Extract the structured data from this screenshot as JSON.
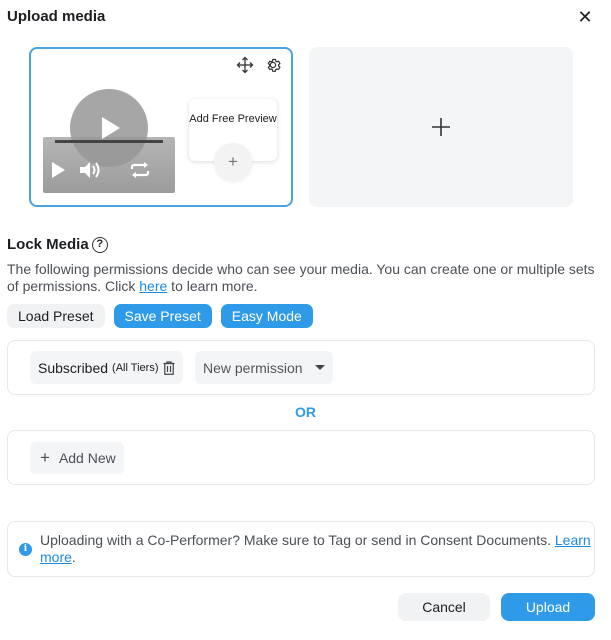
{
  "dialog": {
    "title": "Upload media",
    "close_icon": "close-icon"
  },
  "media": {
    "preview_card": {
      "move_icon": "move-icon",
      "settings_icon": "gear-icon",
      "add_free_preview_label": "Add Free Preview",
      "add_icon": "plus-icon"
    },
    "add_card_icon": "plus-icon"
  },
  "lock_media": {
    "title": "Lock Media",
    "help_icon": "question-circle-icon",
    "description_prefix": "The following permissions decide who can see your media. You can create one or multiple sets of permissions. Click ",
    "description_link": "here",
    "description_suffix": " to learn more.",
    "buttons": {
      "load_preset": "Load Preset",
      "save_preset": "Save Preset",
      "easy_mode": "Easy Mode"
    },
    "permission": {
      "subscribed_label": "Subscribed",
      "subscribed_tiers": "(All Tiers)",
      "trash_icon": "trash-icon",
      "new_permission_label": "New permission",
      "dropdown_icon": "caret-down-icon"
    },
    "or_label": "OR",
    "add_new_label": "Add New"
  },
  "notice": {
    "info_icon": "info-icon",
    "text": "Uploading with a Co-Performer? Make sure to Tag or send in Consent Documents. ",
    "link": "Learn more",
    "suffix": "."
  },
  "footer": {
    "cancel_label": "Cancel",
    "upload_label": "Upload"
  },
  "colors": {
    "accent": "#2f9be8",
    "card_border": "#4aa3df",
    "link": "#1d8be0"
  }
}
